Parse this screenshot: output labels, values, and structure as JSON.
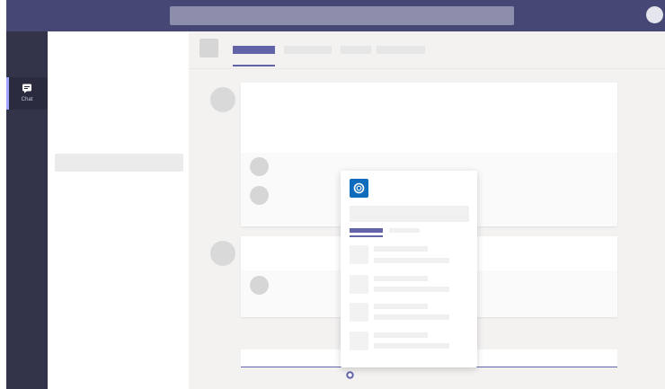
{
  "rail": {
    "chat_label": "Chat"
  },
  "icons": {
    "chat": "chat-icon",
    "app_logo": "app-logo-icon",
    "cursor": "loader-icon"
  },
  "colors": {
    "titlebar": "#464775",
    "rail": "#33344a",
    "accent": "#6264a7",
    "app_brand": "#0f6cbd"
  }
}
